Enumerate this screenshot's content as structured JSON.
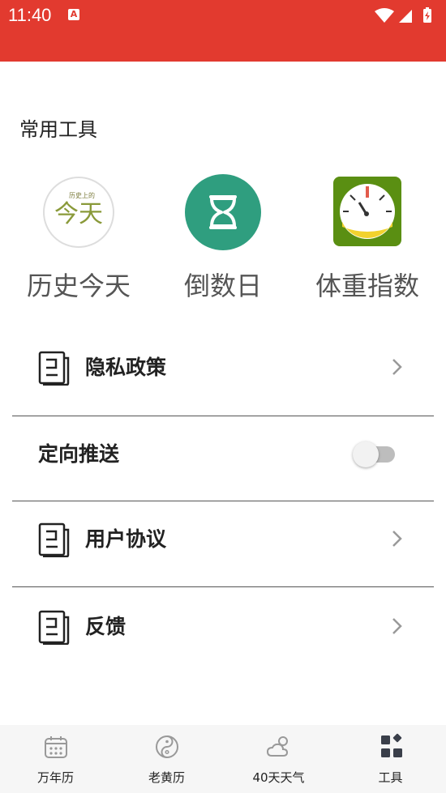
{
  "status_bar": {
    "time": "11:40",
    "notif_icon": "A"
  },
  "section": {
    "title": "常用工具"
  },
  "tools": [
    {
      "label": "历史今天",
      "logo_small": "历史上的",
      "logo_big": "今天"
    },
    {
      "label": "倒数日"
    },
    {
      "label": "体重指数"
    }
  ],
  "menu": {
    "privacy": "隐私政策",
    "push": "定向推送",
    "agreement": "用户协议",
    "feedback": "反馈"
  },
  "push_enabled": false,
  "tabs": [
    {
      "label": "万年历",
      "icon": "calendar-icon"
    },
    {
      "label": "老黄历",
      "icon": "yin-yang-icon"
    },
    {
      "label": "40天天气",
      "icon": "weather-cloud-icon"
    },
    {
      "label": "工具",
      "icon": "grid-icon"
    }
  ],
  "colors": {
    "status_bar": "#e23a2f",
    "countdown_green": "#2f9e7f",
    "bmi_green": "#5a8f12"
  }
}
